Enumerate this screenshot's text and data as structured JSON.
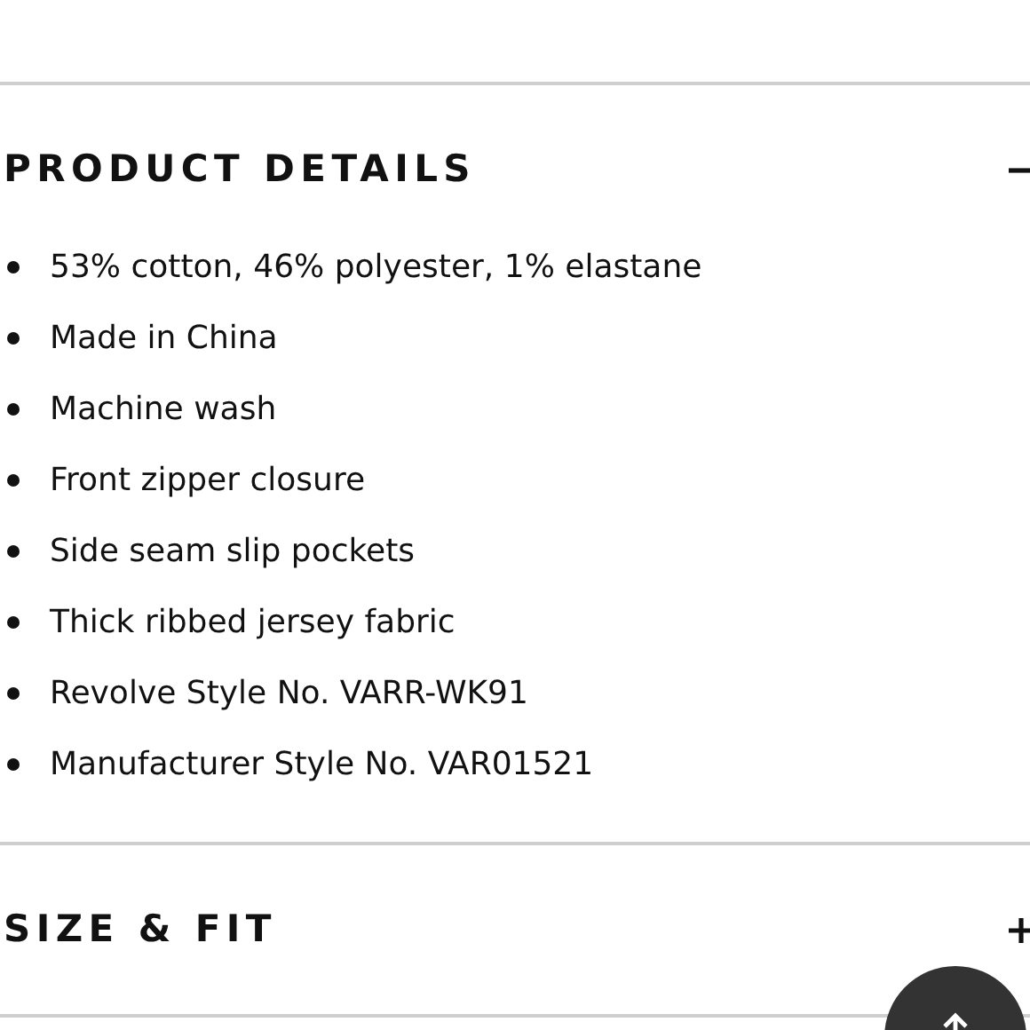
{
  "sections": [
    {
      "title": "PRODUCT DETAILS",
      "expanded": true,
      "items": [
        "53% cotton, 46% polyester, 1% elastane",
        "Made in China",
        "Machine wash",
        "Front zipper closure",
        "Side seam slip pockets",
        "Thick ribbed jersey fabric",
        "Revolve Style No. VARR-WK91",
        "Manufacturer Style No. VAR01521"
      ]
    },
    {
      "title": "SIZE & FIT",
      "expanded": false
    }
  ]
}
